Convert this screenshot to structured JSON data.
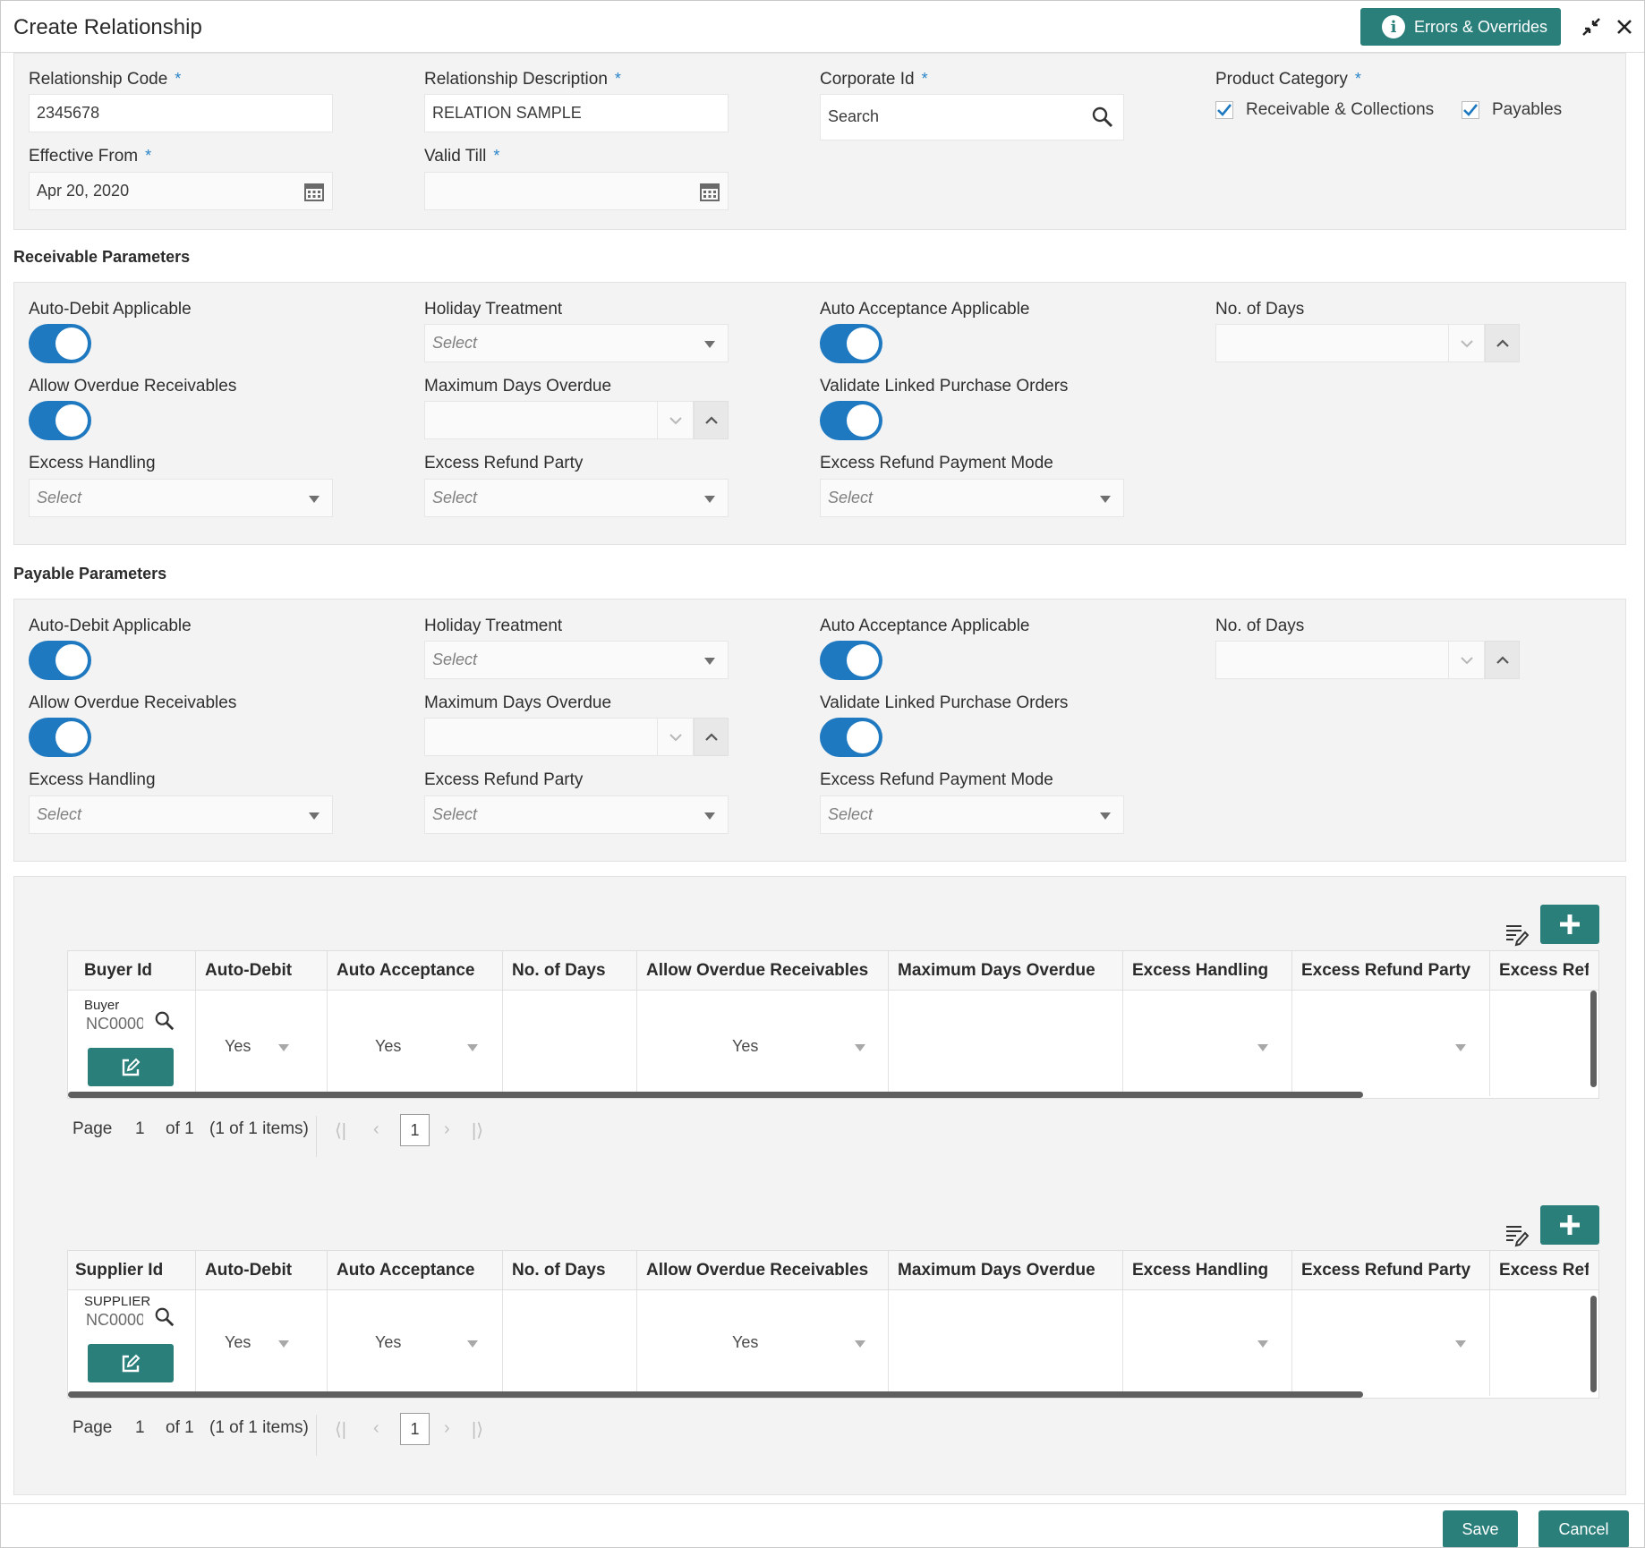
{
  "header": {
    "title": "Create Relationship",
    "errors_button": "Errors & Overrides"
  },
  "general": {
    "relationship_code_label": "Relationship Code",
    "relationship_code_value": "2345678",
    "relationship_desc_label": "Relationship Description",
    "relationship_desc_value": "RELATION SAMPLE",
    "corporate_id_label": "Corporate Id",
    "corporate_id_placeholder": "Search",
    "product_category_label": "Product Category",
    "product_category_options": [
      "Receivable & Collections",
      "Payables"
    ],
    "effective_from_label": "Effective From",
    "effective_from_value": "Apr 20, 2020",
    "valid_till_label": "Valid Till",
    "required_mark": "*"
  },
  "receivable": {
    "title": "Receivable Parameters",
    "auto_debit_label": "Auto-Debit Applicable",
    "auto_debit_on": true,
    "holiday_label": "Holiday Treatment",
    "holiday_value": "Select",
    "auto_accept_label": "Auto Acceptance Applicable",
    "auto_accept_on": true,
    "days_label": "No. of Days",
    "overdue_label": "Allow Overdue Receivables",
    "overdue_on": true,
    "max_days_label": "Maximum Days Overdue",
    "validate_po_label": "Validate Linked Purchase Orders",
    "validate_po_on": true,
    "excess_handling_label": "Excess Handling",
    "excess_handling_value": "Select",
    "refund_party_label": "Excess Refund Party",
    "refund_party_value": "Select",
    "refund_mode_label": "Excess Refund Payment Mode",
    "refund_mode_value": "Select"
  },
  "payable": {
    "title": "Payable Parameters",
    "auto_debit_label": "Auto-Debit Applicable",
    "auto_debit_on": true,
    "holiday_label": "Holiday Treatment",
    "holiday_value": "Select",
    "auto_accept_label": "Auto Acceptance Applicable",
    "auto_accept_on": true,
    "days_label": "No. of Days",
    "overdue_label": "Allow Overdue Receivables",
    "overdue_on": true,
    "max_days_label": "Maximum Days Overdue",
    "validate_po_label": "Validate Linked Purchase Orders",
    "validate_po_on": true,
    "excess_handling_label": "Excess Handling",
    "excess_handling_value": "Select",
    "refund_party_label": "Excess Refund Party",
    "refund_party_value": "Select",
    "refund_mode_label": "Excess Refund Payment Mode",
    "refund_mode_value": "Select"
  },
  "buyer_grid": {
    "columns": [
      "Buyer Id",
      "Auto-Debit",
      "Auto Acceptance",
      "No. of Days",
      "Allow Overdue Receivables",
      "Maximum Days Overdue",
      "Excess Handling",
      "Excess Refund Party",
      "Excess Refur"
    ],
    "row": {
      "id_label": "Buyer",
      "id_value": "NC0000",
      "auto_debit": "Yes",
      "auto_acceptance": "Yes",
      "allow_overdue": "Yes"
    },
    "pager": {
      "page_label": "Page",
      "page_value": "1",
      "of_pages": "of 1",
      "items": "(1 of 1 items)",
      "current": "1"
    }
  },
  "supplier_grid": {
    "columns": [
      "Supplier Id",
      "Auto-Debit",
      "Auto Acceptance",
      "No. of Days",
      "Allow Overdue Receivables",
      "Maximum Days Overdue",
      "Excess Handling",
      "Excess Refund Party",
      "Excess Refur"
    ],
    "row": {
      "id_label": "SUPPLIER",
      "id_value": "NC0000",
      "auto_debit": "Yes",
      "auto_acceptance": "Yes",
      "allow_overdue": "Yes"
    },
    "pager": {
      "page_label": "Page",
      "page_value": "1",
      "of_pages": "of 1",
      "items": "(1 of 1 items)",
      "current": "1"
    }
  },
  "footer": {
    "save_label": "Save",
    "cancel_label": "Cancel"
  },
  "colors": {
    "accent": "#2a7f7b",
    "toggle": "#1f79c0",
    "required": "#2a84c9"
  }
}
